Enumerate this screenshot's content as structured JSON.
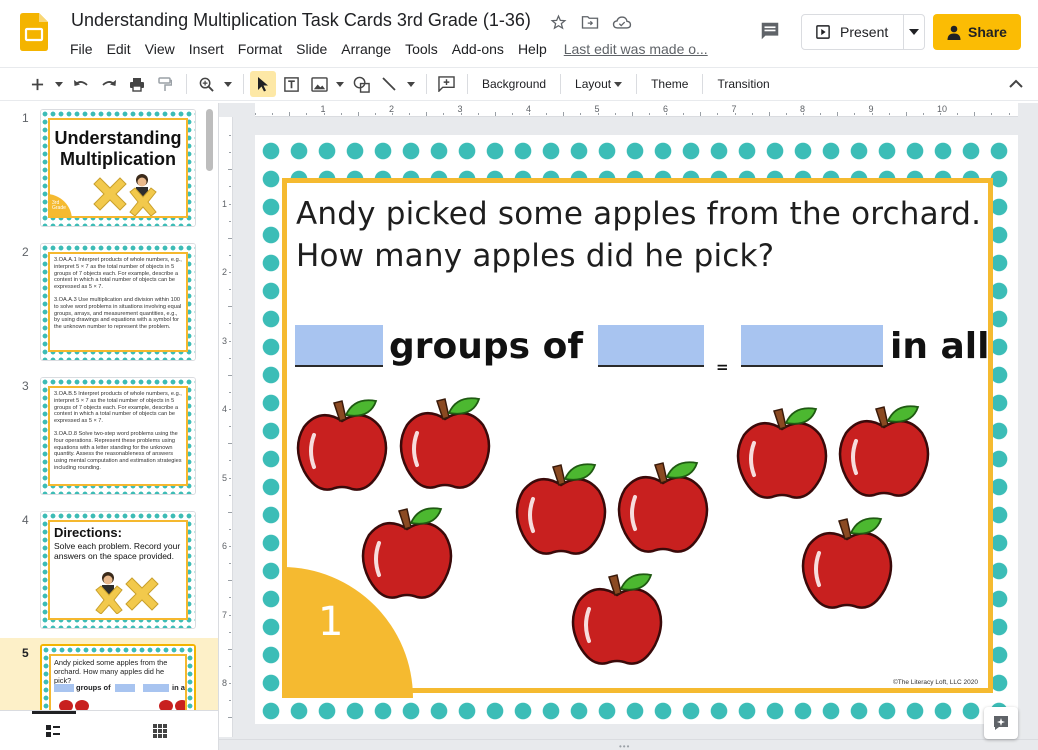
{
  "document": {
    "title": "Understanding Multiplication Task Cards 3rd Grade (1-36)",
    "last_edit": "Last edit was made o..."
  },
  "menu": [
    "File",
    "Edit",
    "View",
    "Insert",
    "Format",
    "Slide",
    "Arrange",
    "Tools",
    "Add-ons",
    "Help"
  ],
  "buttons": {
    "present": "Present",
    "share": "Share"
  },
  "toolbar": {
    "background": "Background",
    "layout": "Layout",
    "theme": "Theme",
    "transition": "Transition"
  },
  "slides": [
    {
      "number": "1",
      "title": "Understanding Multiplication",
      "badge": "3rd Grade"
    },
    {
      "number": "2",
      "standards": [
        "3.OA.A.1 Interpret products of whole numbers, e.g., interpret 5 × 7 as the total number of objects in 5 groups of 7 objects each. For example, describe a context in which a total number of objects can be expressed as 5 × 7.",
        "3.OA.A.3 Use multiplication and division within 100 to solve word problems in situations involving equal groups, arrays, and measurement quantities, e.g., by using drawings and equations with a symbol for the unknown number to represent the problem."
      ]
    },
    {
      "number": "3",
      "standards": [
        "3.OA.B.5 Interpret products of whole numbers, e.g., interpret 5 × 7 as the total number of objects in 5 groups of 7 objects each. For example, describe a context in which a total number of objects can be expressed as 5 × 7.",
        "3.OA.D.8 Solve two-step word problems using the four operations. Represent these problems using equations with a letter standing for the unknown quantity. Assess the reasonableness of answers using mental computation and estimation strategies including rounding."
      ]
    },
    {
      "number": "4",
      "title": "Directions:",
      "text": "Solve each problem. Record your answers on the space provided."
    },
    {
      "number": "5",
      "question": "Andy picked some apples from the orchard.  How many apples did he pick?",
      "groups_of": "groups of",
      "in_all": "in all"
    }
  ],
  "ruler": {
    "top": [
      "1",
      "2",
      "3",
      "4",
      "5",
      "6",
      "7",
      "8",
      "9",
      "10"
    ],
    "left": [
      "1",
      "2",
      "3",
      "4",
      "5",
      "6",
      "7",
      "8"
    ]
  },
  "slide": {
    "question": "Andy picked some apples from the orchard.  How many apples did he pick?",
    "groups_of": "groups of",
    "equals": "=",
    "in_all": "in all",
    "card_number": "1",
    "copyright": "©The Literacy Loft, LLC 2020",
    "apple_count": 9
  },
  "colors": {
    "polka_dot": "#3cbdb7",
    "card_border": "#f5ba30",
    "answer_blank": "#a8c4f0",
    "share_button": "#fbbc04",
    "apple_red": "#c8201f"
  }
}
